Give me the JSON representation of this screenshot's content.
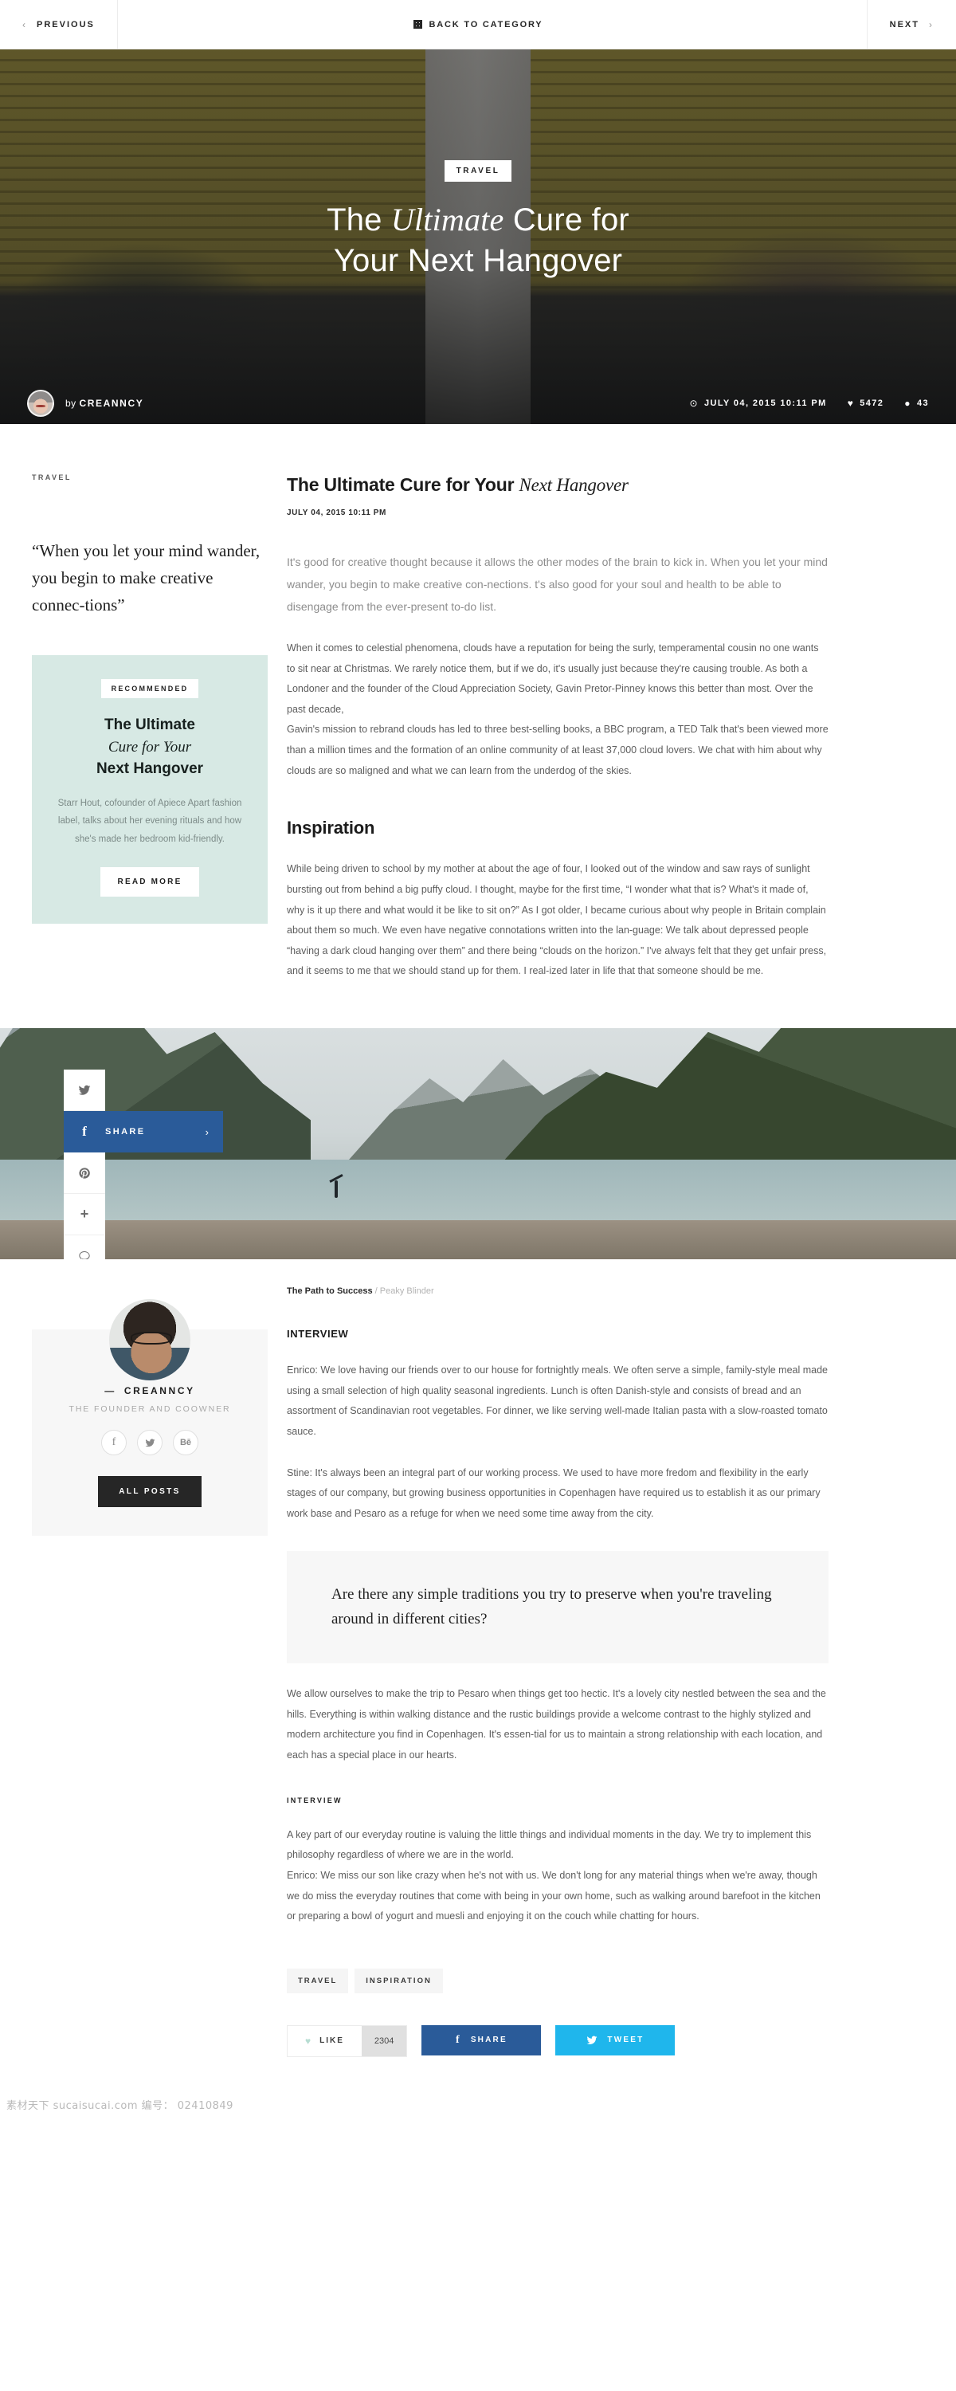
{
  "topnav": {
    "previous": "PREVIOUS",
    "prev_arrow": "‹",
    "category": "BACK TO CATEGORY",
    "next": "NEXT",
    "next_arrow": "›"
  },
  "hero": {
    "category_badge": "TRAVEL",
    "title_part1": "The ",
    "title_italic": "Ultimate",
    "title_part2": " Cure for",
    "title_line2": "Your Next Hangover",
    "by_prefix": "by ",
    "author": "CREANNCY",
    "clock_icon": "⊙",
    "date": "JULY 04, 2015 10:11 PM",
    "heart_icon": "♥",
    "likes": "5472",
    "comment_icon": "●",
    "comments": "43"
  },
  "article": {
    "eyebrow": "TRAVEL",
    "title_plain": "The Ultimate Cure for Your ",
    "title_italic": "Next Hangover",
    "date": "JULY 04, 2015 10:11 PM",
    "pullquote": "“When you let your mind wander, you begin to make creative connec-tions”",
    "lede": "It's good for creative thought because it allows the other modes of the brain to kick in. When you let your mind wander, you begin to make creative con-nections. t's also good for your soul and health to be able to disengage from the ever-present to-do list.",
    "paragraph1": "When it comes to celestial phenomena, clouds have a reputation for being the surly, temperamental cousin no one wants to sit near at Christmas. We rarely notice them, but if we do, it's usually just because they're causing trouble. As both a Londoner and the founder of the Cloud Appreciation Society, Gavin Pretor-Pinney knows this better than most. Over the past decade,",
    "paragraph2": "Gavin's mission to rebrand clouds has led to three best-selling books, a BBC program, a TED Talk that's been viewed more than a million times and the formation of an online community of at least 37,000 cloud lovers. We chat with him about why clouds are so maligned and  what we can learn from the underdog of the skies.",
    "heading_inspiration": "Inspiration",
    "paragraph3": "While being driven to school by my mother at about the age of four, I looked out of the window and saw rays of sunlight bursting out from behind a big puffy cloud. I thought, maybe for the first time, “I wonder what that is? What's it made of, why is it up there and what would it be like to sit on?” As I got older, I became curious about why people in Britain complain about them so much. We even have negative connotations written into the lan-guage: We talk about depressed people “having a dark cloud hanging over them” and there being “clouds on the horizon.” I've always felt that they get unfair press, and it seems to me that we should stand up for them. I real-ized later in life that that someone should be me."
  },
  "recommended": {
    "badge": "RECOMMENDED",
    "title_line1": "The Ultimate",
    "title_italic": "Cure for Your",
    "title_line3": "Next Hangover",
    "description": "Starr Hout, cofounder of Apiece Apart fashion label, talks about her evening rituals and how she's made her bedroom kid-friendly.",
    "button": "READ MORE"
  },
  "share_rail": {
    "twitter_icon": "twitter-icon",
    "facebook_icon": "facebook-icon",
    "facebook_label": "SHARE",
    "facebook_chevron": "›",
    "pinterest_icon": "pinterest-icon",
    "plus_icon": "+",
    "comment_icon": "comment-icon",
    "facebook_color": "#2a5b99"
  },
  "interview": {
    "breadcrumb_current": "The Path to Success",
    "breadcrumb_sep": " / ",
    "breadcrumb_parent": "Peaky Blinder",
    "heading": "INTERVIEW",
    "paragraph1": "Enrico: We love having our friends over to our house for fortnightly meals. We often serve a simple, family-style meal made using a small selection of high quality seasonal ingredients. Lunch is often Danish-style and consists of bread and an assortment of Scandinavian root vegetables. For dinner, we like serving well-made Italian pasta with a slow-roasted tomato sauce.",
    "paragraph2": "Stine: It's always been an integral part of our working process. We used to have more fredom and flexibility in the early stages of our company, but growing business opportunities in Copenhagen have required us to establish it as our primary work base and Pesaro as a refuge for when we need some time away from the city.",
    "question": "Are there any simple traditions you try to preserve when you're traveling around in different cities?",
    "paragraph3": "We allow ourselves to make the trip to Pesaro when things get too hectic. It's a lovely city nestled between the sea and the hills. Everything is within walking distance and the rustic buildings provide a welcome contrast to the highly stylized and modern architecture you find in Copenhagen. It's essen-tial for us to maintain a strong relationship with each location, and each has a special place in our hearts.",
    "heading2": "INTERVIEW",
    "paragraph4": "A key part of our everyday routine is valuing the little things and individual moments in the day. We try to implement this philosophy regardless of where we are in the world.",
    "paragraph5": "Enrico: We miss our son like crazy when he's not with us. We don't long for any material things when we're away, though we do miss the everyday routines that come with being in your own home, such as walking around barefoot in the kitchen or preparing a bowl of yogurt and muesli and enjoying it on the couch while chatting for hours."
  },
  "author_card": {
    "dash": "—",
    "name": "CREANNCY",
    "role": "THE FOUNDER AND COOWNER",
    "social_facebook": "facebook-icon",
    "social_twitter": "twitter-icon",
    "social_behance": "Bē",
    "button": "ALL POSTS"
  },
  "tags": [
    "TRAVEL",
    "INSPIRATION"
  ],
  "actions": {
    "like_icon": "♥",
    "like_label": "LIKE",
    "like_count": "2304",
    "facebook_mark": "f",
    "facebook_label": "SHARE",
    "facebook_color": "#2a5b99",
    "twitter_label": "TWEET",
    "twitter_color": "#1fb6ec"
  },
  "watermark": {
    "text": "素材天下 sucaisucai.com   编号： 02410849"
  }
}
